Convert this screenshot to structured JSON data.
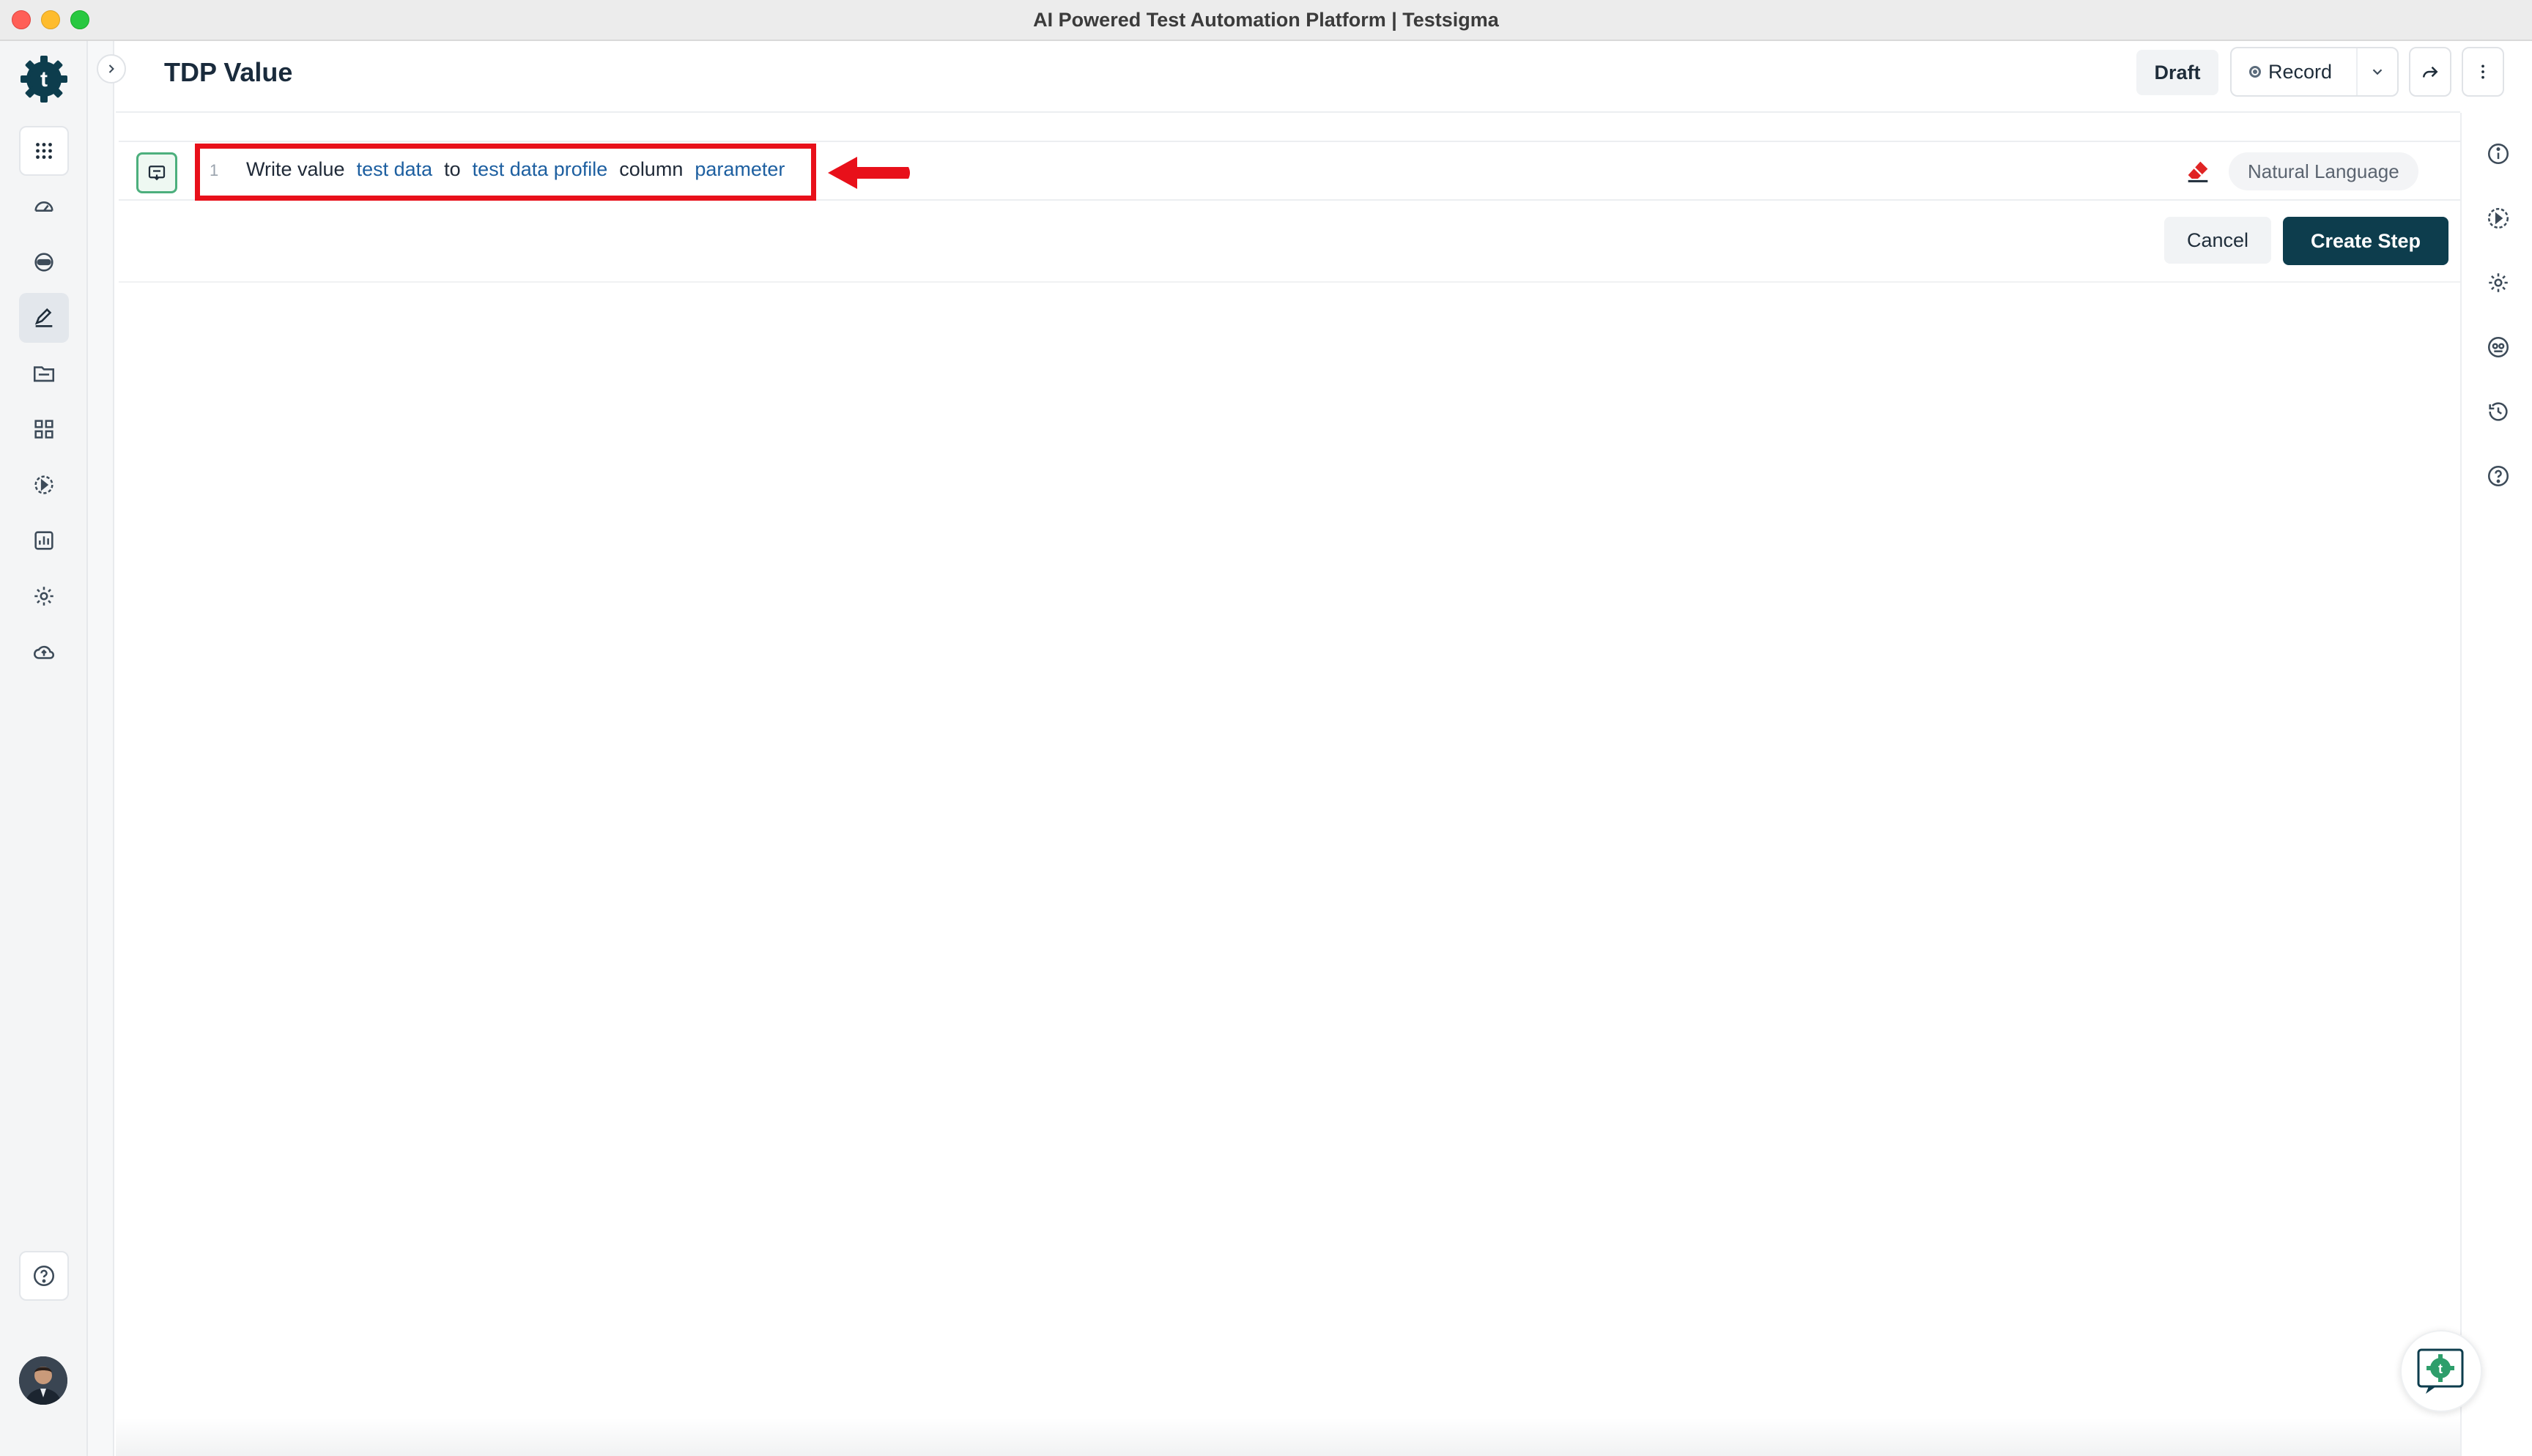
{
  "window": {
    "title": "AI Powered Test Automation Platform | Testsigma"
  },
  "nav": {
    "items": [
      {
        "name": "apps-grid-icon"
      },
      {
        "name": "dashboard-icon"
      },
      {
        "name": "agents-icon"
      },
      {
        "name": "test-cases-icon"
      },
      {
        "name": "test-data-icon"
      },
      {
        "name": "elements-icon"
      },
      {
        "name": "runs-icon"
      },
      {
        "name": "reports-icon"
      },
      {
        "name": "settings-icon"
      },
      {
        "name": "cloud-upload-icon"
      }
    ],
    "help_icon": "help-circle-icon"
  },
  "header": {
    "title": "TDP Value",
    "draft_label": "Draft",
    "record_label": "Record"
  },
  "step": {
    "number": "1",
    "tokens": [
      {
        "text": "Write value",
        "kind": "plain"
      },
      {
        "text": "test data",
        "kind": "param"
      },
      {
        "text": "to",
        "kind": "plain"
      },
      {
        "text": "test data profile",
        "kind": "param"
      },
      {
        "text": "column",
        "kind": "plain"
      },
      {
        "text": "parameter",
        "kind": "param"
      }
    ],
    "mode_label": "Natural Language"
  },
  "actions": {
    "cancel_label": "Cancel",
    "create_label": "Create Step"
  },
  "colors": {
    "brand": "#0d3d4d",
    "param": "#1d5fa0",
    "highlight": "#e8101a",
    "step_icon": "#4caf7d"
  }
}
